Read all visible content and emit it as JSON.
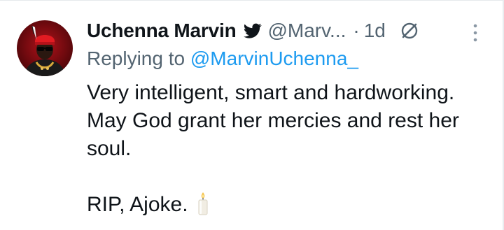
{
  "tweet": {
    "author_name": "Uchenna Marvin",
    "author_handle": "@Marv...",
    "separator": "·",
    "time": "1d",
    "replying_to_prefix": "Replying to ",
    "replying_to_handle": "@MarvinUchenna_",
    "text_line_1": "Very intelligent, smart and hardworking. May God grant her mercies and rest her soul.",
    "text_line_2": "RIP, Ajoke.",
    "emoji": "candle"
  },
  "icons": {
    "verified_badge": "twitter-bird-icon",
    "grok": "grok-icon",
    "more": "more-vertical-icon"
  },
  "colors": {
    "text_primary": "#0f1419",
    "text_secondary": "#536471",
    "accent_blue": "#1d9bf0"
  }
}
